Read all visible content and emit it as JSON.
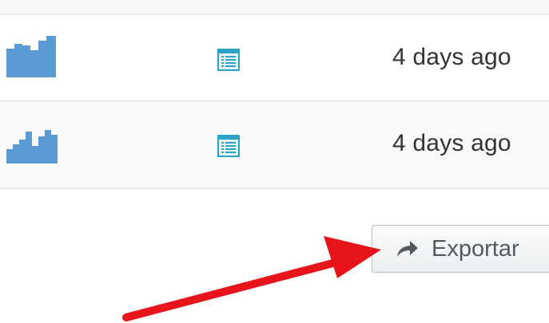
{
  "rows": [
    {
      "time": "4 days ago",
      "sparkline_icon": "bar-sparkline-icon",
      "doc_icon": "table-document-icon"
    },
    {
      "time": "4 days ago",
      "sparkline_icon": "bar-sparkline-icon",
      "doc_icon": "table-document-icon"
    }
  ],
  "actions": {
    "export_label": "Exportar",
    "export_icon": "share-arrow-icon"
  },
  "annotation": {
    "arrow_color": "#e8141c"
  },
  "colors": {
    "sparkline": "#5b9bd5",
    "doc_icon": "#2aa3c4",
    "row_alt_bg": "#f9f9f9"
  }
}
